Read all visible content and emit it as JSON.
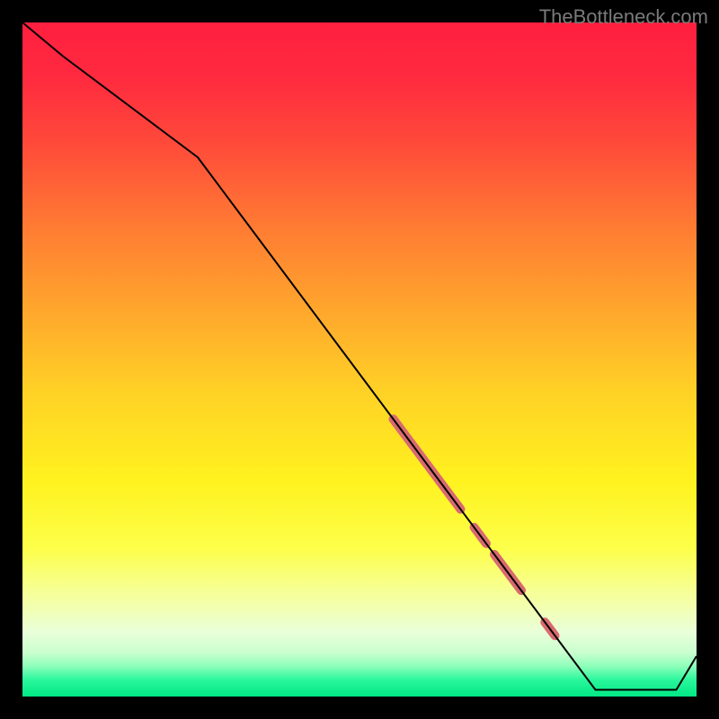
{
  "watermark": "TheBottleneck.com",
  "chart_data": {
    "type": "line",
    "title": "",
    "xlabel": "",
    "ylabel": "",
    "xlim": [
      0,
      100
    ],
    "ylim": [
      0,
      100
    ],
    "series": [
      {
        "name": "main-curve",
        "x": [
          0,
          6,
          26,
          85,
          97,
          100
        ],
        "values": [
          100,
          95,
          80,
          1,
          1,
          6
        ],
        "color": "#000000",
        "width": 2
      }
    ],
    "highlight_segments": [
      {
        "x_start": 55,
        "x_end": 65,
        "thickness": 10,
        "color": "#d86a6f"
      },
      {
        "x_start": 67.0,
        "x_end": 68.8,
        "thickness": 10,
        "color": "#d86a6f"
      },
      {
        "x_start": 70,
        "x_end": 74,
        "thickness": 10,
        "color": "#d86a6f"
      },
      {
        "x_start": 77.5,
        "x_end": 79.0,
        "thickness": 10,
        "color": "#d86a6f"
      }
    ],
    "background": {
      "type": "vertical-gradient",
      "stops": [
        {
          "pos": 0.0,
          "color": "#ff1f3f"
        },
        {
          "pos": 0.08,
          "color": "#ff2a3f"
        },
        {
          "pos": 0.18,
          "color": "#ff4a3a"
        },
        {
          "pos": 0.3,
          "color": "#ff7a33"
        },
        {
          "pos": 0.42,
          "color": "#ffa42d"
        },
        {
          "pos": 0.55,
          "color": "#ffd226"
        },
        {
          "pos": 0.68,
          "color": "#fff21f"
        },
        {
          "pos": 0.78,
          "color": "#fdff4a"
        },
        {
          "pos": 0.86,
          "color": "#f4ffa8"
        },
        {
          "pos": 0.905,
          "color": "#e9ffda"
        },
        {
          "pos": 0.935,
          "color": "#c9ffcf"
        },
        {
          "pos": 0.955,
          "color": "#8dffba"
        },
        {
          "pos": 0.975,
          "color": "#2bf79c"
        },
        {
          "pos": 1.0,
          "color": "#00e884"
        }
      ]
    }
  }
}
